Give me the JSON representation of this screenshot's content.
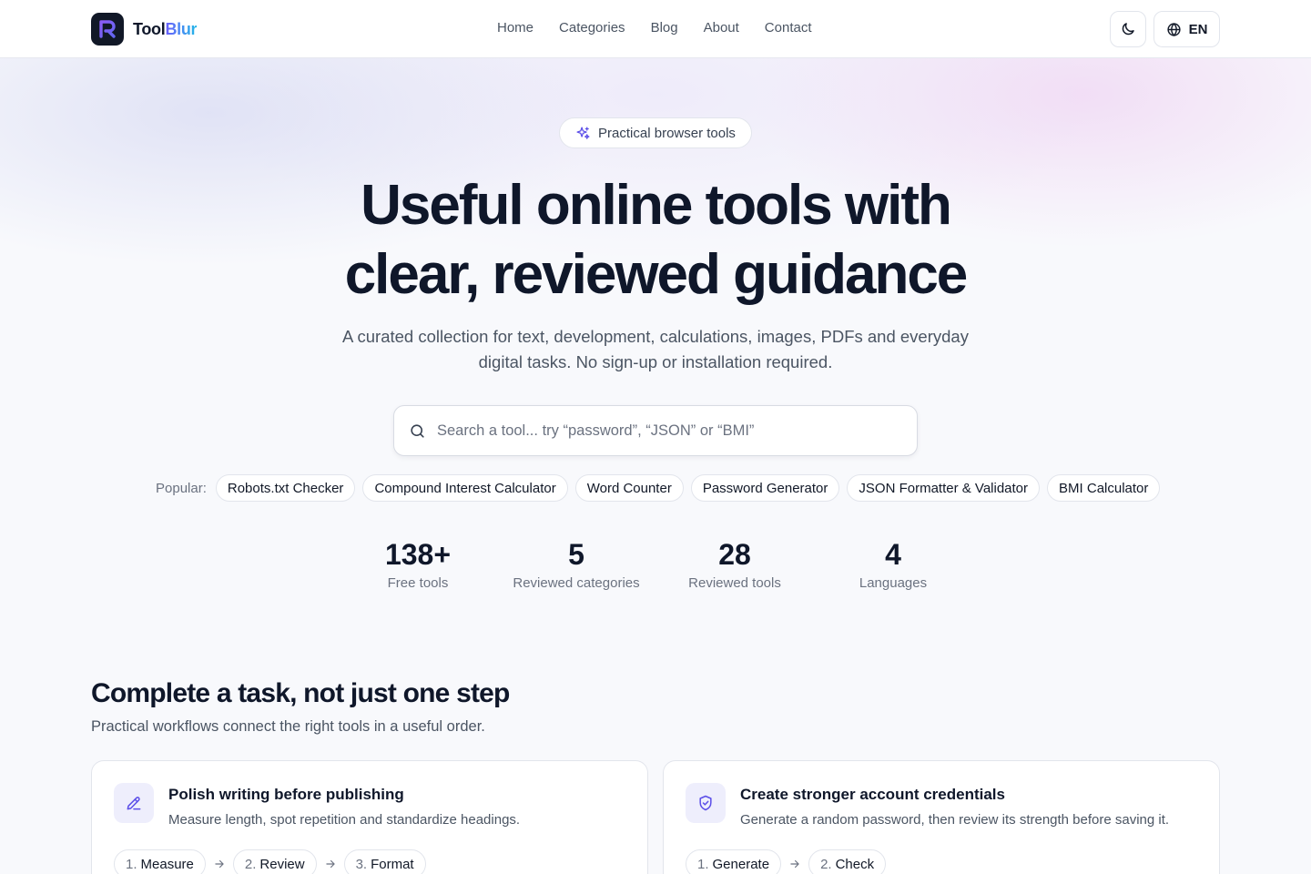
{
  "brand": {
    "left": "Tool",
    "right": "Blur"
  },
  "nav": {
    "items": [
      "Home",
      "Categories",
      "Blog",
      "About",
      "Contact"
    ]
  },
  "header": {
    "language": "EN"
  },
  "hero": {
    "badge": "Practical browser tools",
    "title_line1": "Useful online tools with",
    "title_line2": "clear, reviewed guidance",
    "subtitle": "A curated collection for text, development, calculations, images, PDFs and everyday digital tasks. No sign-up or installation required.",
    "search_placeholder": "Search a tool... try “password”, “JSON” or “BMI”",
    "popular_label": "Popular:",
    "popular": [
      "Robots.txt Checker",
      "Compound Interest Calculator",
      "Word Counter",
      "Password Generator",
      "JSON Formatter & Validator",
      "BMI Calculator"
    ]
  },
  "stats": [
    {
      "value": "138+",
      "label": "Free tools"
    },
    {
      "value": "5",
      "label": "Reviewed categories"
    },
    {
      "value": "28",
      "label": "Reviewed tools"
    },
    {
      "value": "4",
      "label": "Languages"
    }
  ],
  "workflows": {
    "title": "Complete a task, not just one step",
    "subtitle": "Practical workflows connect the right tools in a useful order.",
    "cards": [
      {
        "icon": "pencil-icon",
        "title": "Polish writing before publishing",
        "desc": "Measure length, spot repetition and standardize headings.",
        "steps": [
          {
            "num": "1.",
            "label": "Measure"
          },
          {
            "num": "2.",
            "label": "Review"
          },
          {
            "num": "3.",
            "label": "Format"
          }
        ]
      },
      {
        "icon": "shield-check-icon",
        "title": "Create stronger account credentials",
        "desc": "Generate a random password, then review its strength before saving it.",
        "steps": [
          {
            "num": "1.",
            "label": "Generate"
          },
          {
            "num": "2.",
            "label": "Check"
          }
        ]
      }
    ]
  },
  "colors": {
    "accent": "#5b4ee8",
    "text": "#0f172a",
    "muted": "#6b7280",
    "border": "#e2e5ec"
  }
}
